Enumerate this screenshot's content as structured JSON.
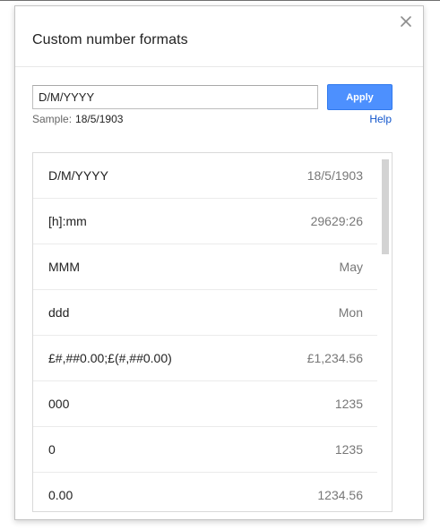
{
  "dialog": {
    "title": "Custom number formats",
    "close_icon": "close-icon"
  },
  "format_input": {
    "value": "D/M/YYYY"
  },
  "apply_button": {
    "label": "Apply",
    "color": "#4d90fe"
  },
  "sample": {
    "label": "Sample:",
    "value": "18/5/1903"
  },
  "help_link": {
    "label": "Help",
    "color": "#1155cc"
  },
  "formats": [
    {
      "format": "D/M/YYYY",
      "example": "18/5/1903"
    },
    {
      "format": "[h]:mm",
      "example": "29629:26"
    },
    {
      "format": "MMM",
      "example": "May"
    },
    {
      "format": "ddd",
      "example": "Mon"
    },
    {
      "format": "£#,##0.00;£(#,##0.00)",
      "example": "£1,234.56"
    },
    {
      "format": "000",
      "example": "1235"
    },
    {
      "format": "0",
      "example": "1235"
    },
    {
      "format": "0.00",
      "example": "1234.56"
    }
  ]
}
